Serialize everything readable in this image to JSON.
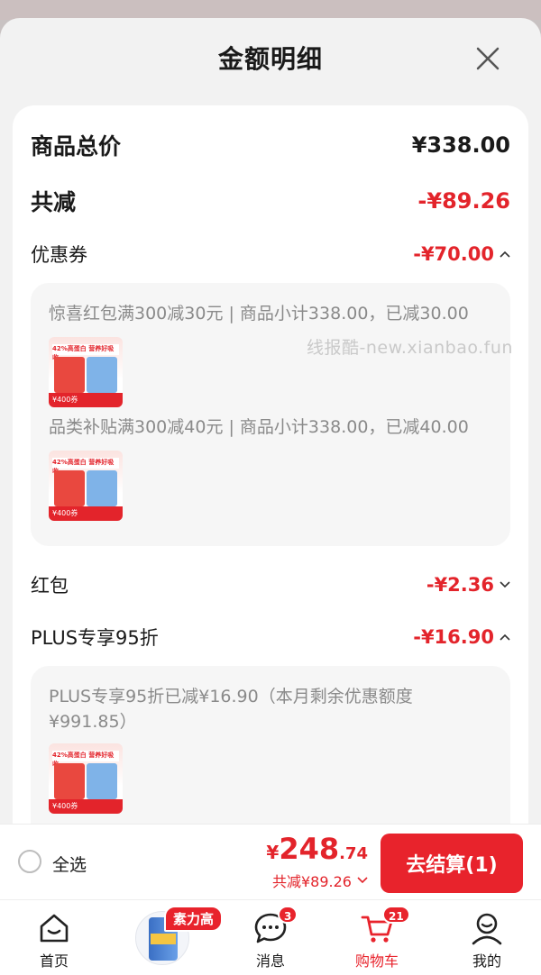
{
  "sheet": {
    "title": "金额明细",
    "close_icon": "close-icon"
  },
  "summary": {
    "total_label": "商品总价",
    "total_value": "¥338.00",
    "discount_label": "共减",
    "discount_value": "-¥89.26"
  },
  "coupon": {
    "label": "优惠券",
    "value": "-¥70.00",
    "items": [
      {
        "text": "惊喜红包满300减30元 | 商品小计338.00，已减30.00"
      },
      {
        "text": "品类补贴满300减40元 | 商品小计338.00，已减40.00"
      }
    ]
  },
  "redpacket": {
    "label": "红包",
    "value": "-¥2.36"
  },
  "plus": {
    "label": "PLUS专享95折",
    "value": "-¥16.90",
    "detail": "PLUS专享95折已减¥16.90（本月剩余优惠额度¥991.85）"
  },
  "product_thumb": {
    "band_text": "42%高蛋白 营养好吸收",
    "foot_text": "¥400券"
  },
  "watermark": "线报酷-new.xianbao.fun",
  "checkout": {
    "select_all": "全选",
    "price_currency": "¥",
    "price_int": "248",
    "price_dec": ".74",
    "saved": "共减¥89.26",
    "pay_button": "去结算(1)"
  },
  "tabbar": {
    "home": "首页",
    "promo_badge": "素力高",
    "messages": "消息",
    "messages_badge": "3",
    "cart": "购物车",
    "cart_badge": "21",
    "mine": "我的"
  },
  "colors": {
    "accent": "#e8232c",
    "price_red": "#e3242b"
  }
}
